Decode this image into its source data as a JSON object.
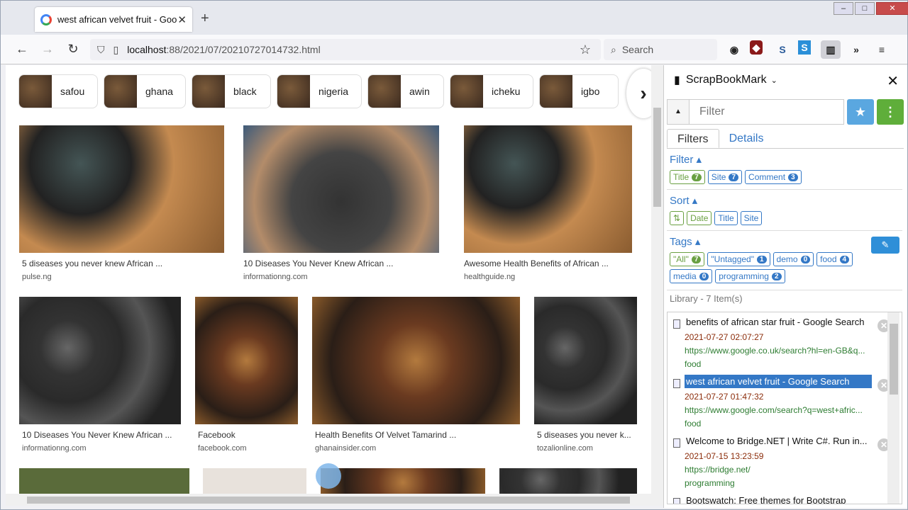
{
  "browser": {
    "tab_title": "west african velvet fruit - Googl",
    "close": "✕",
    "newtab": "+",
    "url_host": "localhost",
    "url_rest": ":88/2021/07/20210727014732.html",
    "search_placeholder": "Search"
  },
  "chips": [
    {
      "label": "safou"
    },
    {
      "label": "ghana"
    },
    {
      "label": "black"
    },
    {
      "label": "nigeria"
    },
    {
      "label": "awin"
    },
    {
      "label": "icheku"
    },
    {
      "label": "igbo"
    }
  ],
  "results": [
    {
      "caption": "5 diseases you never knew African ...",
      "source": "pulse.ng"
    },
    {
      "caption": "10 Diseases You Never Knew African ...",
      "source": "informationng.com"
    },
    {
      "caption": "Awesome Health Benefits of African ...",
      "source": "healthguide.ng"
    },
    {
      "caption": "10 Diseases You Never Knew African ...",
      "source": "informationng.com"
    },
    {
      "caption": "Facebook",
      "source": "facebook.com"
    },
    {
      "caption": "Health Benefits Of Velvet Tamarind ...",
      "source": "ghanainsider.com"
    },
    {
      "caption": "5 diseases you never k...",
      "source": "tozalionline.com"
    }
  ],
  "sidebar": {
    "title": "ScrapBookMark",
    "filter_placeholder": "Filter",
    "tab_filters": "Filters",
    "tab_details": "Details",
    "filter_title": "Filter",
    "filter_tags": [
      {
        "label": "Title",
        "count": "7"
      },
      {
        "label": "Site",
        "count": "7"
      },
      {
        "label": "Comment",
        "count": "3"
      }
    ],
    "sort_title": "Sort",
    "sort_tags": [
      "Date",
      "Title",
      "Site"
    ],
    "tags_title": "Tags",
    "tags": [
      {
        "label": "\"All\"",
        "count": "7"
      },
      {
        "label": "\"Untagged\"",
        "count": "1"
      },
      {
        "label": "demo",
        "count": "0"
      },
      {
        "label": "food",
        "count": "4"
      },
      {
        "label": "media",
        "count": "0"
      },
      {
        "label": "programming",
        "count": "2"
      }
    ],
    "library_label": "Library - 7 Item(s)",
    "items": [
      {
        "title": "benefits of african star fruit - Google Search",
        "date": "2021-07-27 02:07:27",
        "url": "https://www.google.co.uk/search?hl=en-GB&q...",
        "tag": "food"
      },
      {
        "title": "west african velvet fruit - Google Search",
        "date": "2021-07-27 01:47:32",
        "url": "https://www.google.com/search?q=west+afric...",
        "tag": "food"
      },
      {
        "title": "Welcome to Bridge.NET | Write C#. Run in...",
        "date": "2021-07-15 13:23:59",
        "url": "https://bridge.net/",
        "tag": "programming"
      },
      {
        "title": "Bootswatch: Free themes for Bootstrap",
        "date": "",
        "url": "",
        "tag": ""
      }
    ]
  }
}
